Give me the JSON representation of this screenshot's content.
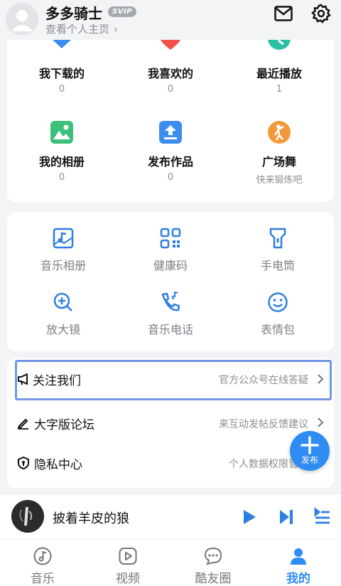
{
  "header": {
    "username": "多多骑士",
    "badge": "SVIP",
    "profile_link": "查看个人主页",
    "chevron": "›"
  },
  "stats": [
    {
      "label": "我下载的",
      "sub": "0",
      "icon": "download-icon",
      "color": "#3b8cf0"
    },
    {
      "label": "我喜欢的",
      "sub": "0",
      "icon": "heart-icon",
      "color": "#f2504b"
    },
    {
      "label": "最近播放",
      "sub": "1",
      "icon": "clock-icon",
      "color": "#2bbfa3"
    },
    {
      "label": "我的相册",
      "sub": "0",
      "icon": "photo-album-icon",
      "color": "#3cc07a"
    },
    {
      "label": "发布作品",
      "sub": "0",
      "icon": "upload-icon",
      "color": "#3b8cf0"
    },
    {
      "label": "广场舞",
      "sub": "快来锻炼吧",
      "icon": "dancer-icon",
      "color": "#f3993a"
    }
  ],
  "tools": [
    {
      "label": "音乐相册",
      "icon": "music-album-icon"
    },
    {
      "label": "健康码",
      "icon": "qr-code-icon"
    },
    {
      "label": "手电筒",
      "icon": "flashlight-icon"
    },
    {
      "label": "放大镜",
      "icon": "magnifier-icon"
    },
    {
      "label": "音乐电话",
      "icon": "music-phone-icon"
    },
    {
      "label": "表情包",
      "icon": "emoji-icon"
    }
  ],
  "rows": [
    {
      "title": "关注我们",
      "desc": "官方公众号在线答疑",
      "icon": "megaphone-icon"
    },
    {
      "title": "大字版论坛",
      "desc": "来互动发帖反馈建议",
      "icon": "pencil-icon"
    },
    {
      "title": "隐私中心",
      "desc": "个人数据权限管理",
      "icon": "privacy-shield-icon"
    }
  ],
  "fab": {
    "label": "发布"
  },
  "player": {
    "song": "披着羊皮的狼"
  },
  "nav": [
    {
      "label": "音乐",
      "icon": "music-note-icon",
      "active": false
    },
    {
      "label": "视频",
      "icon": "video-icon",
      "active": false
    },
    {
      "label": "酷友圈",
      "icon": "chat-bubble-icon",
      "active": false
    },
    {
      "label": "我的",
      "icon": "profile-icon",
      "active": true
    }
  ],
  "colors": {
    "accent": "#2f8cf3",
    "highlight_border": "#7396e4"
  }
}
